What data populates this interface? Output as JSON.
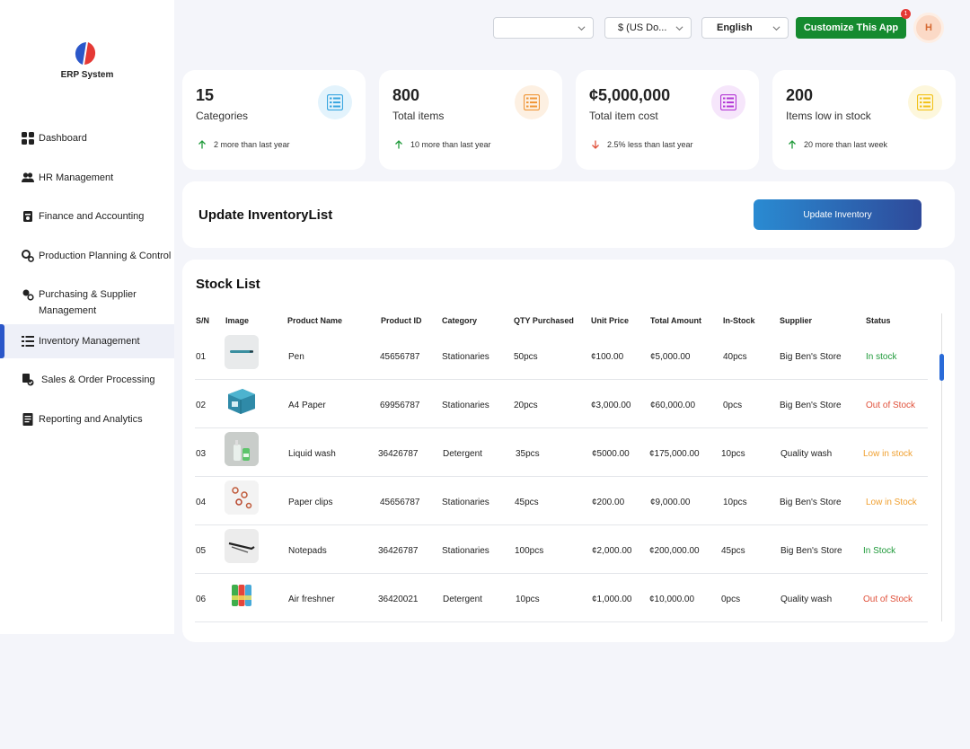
{
  "brand": {
    "name": "ERP System",
    "colors": {
      "left": "#2b57c9",
      "right": "#e53935"
    }
  },
  "sidebar": {
    "items": [
      {
        "label": "Dashboard",
        "icon": "grid-icon"
      },
      {
        "label": "HR Management",
        "icon": "users-icon"
      },
      {
        "label": "Finance and Accounting",
        "icon": "finance-icon"
      },
      {
        "label": "Production Planning & Control",
        "icon": "gears-icon"
      },
      {
        "label": "Purchasing & Supplier Management",
        "icon": "purchasing-icon"
      },
      {
        "label": "Inventory Management",
        "icon": "list-icon",
        "active": true
      },
      {
        "label": "Sales & Order Processing",
        "icon": "sales-icon"
      },
      {
        "label": "Reporting and Analytics",
        "icon": "report-icon"
      }
    ]
  },
  "topbar": {
    "branch_select": "",
    "currency_select": "$ (US Do...",
    "language_select": "English",
    "customize_label": "Customize This App",
    "notification_count": "1",
    "avatar_initial": "H"
  },
  "stats": [
    {
      "value": "15",
      "label": "Categories",
      "trend": "2 more than last year",
      "direction": "up",
      "icon_color": "#3aa6e0",
      "bg": "#e3f3fc"
    },
    {
      "value": "800",
      "label": "Total items",
      "trend": "10 more than last year",
      "direction": "up",
      "icon_color": "#f0973a",
      "bg": "#fdf0e2"
    },
    {
      "value": "¢5,000,000",
      "label": "Total item cost",
      "trend": "2.5% less than last year",
      "direction": "down",
      "icon_color": "#b43ad6",
      "bg": "#f6e6fb"
    },
    {
      "value": "200",
      "label": "Items low in stock",
      "trend": "20 more than last week",
      "direction": "up",
      "icon_color": "#f2c21b",
      "bg": "#fdf7dc"
    }
  ],
  "update_panel": {
    "title": "Update InventoryList",
    "button_label": "Update Inventory"
  },
  "stock_list": {
    "title": "Stock List",
    "columns": [
      "S/N",
      "Image",
      "Product Name",
      "Product ID",
      "Category",
      "QTY Purchased",
      "Unit Price",
      "Total Amount",
      "In-Stock",
      "Supplier",
      "Status"
    ],
    "rows": [
      {
        "sn": "01",
        "image": "pen-image",
        "name": "Pen",
        "id": "45656787",
        "category": "Stationaries",
        "qty": "50pcs",
        "unit_price": "¢100.00",
        "total": "¢5,000.00",
        "in_stock": "40pcs",
        "supplier": "Big Ben's Store",
        "status": "In stock",
        "status_type": "in"
      },
      {
        "sn": "02",
        "image": "paper-image",
        "name": "A4 Paper",
        "id": "69956787",
        "category": "Stationaries",
        "qty": "20pcs",
        "unit_price": "¢3,000.00",
        "total": "¢60,000.00",
        "in_stock": "0pcs",
        "supplier": "Big Ben's Store",
        "status": "Out of Stock",
        "status_type": "out"
      },
      {
        "sn": "03",
        "image": "liquid-wash-image",
        "name": "Liquid wash",
        "id": "36426787",
        "category": "Detergent",
        "qty": "35pcs",
        "unit_price": "¢5000.00",
        "total": "¢175,000.00",
        "in_stock": "10pcs",
        "supplier": "Quality wash",
        "status": "Low in stock",
        "status_type": "low"
      },
      {
        "sn": "04",
        "image": "paper-clips-image",
        "name": "Paper clips",
        "id": "45656787",
        "category": "Stationaries",
        "qty": "45pcs",
        "unit_price": "¢200.00",
        "total": "¢9,000.00",
        "in_stock": "10pcs",
        "supplier": "Big Ben's Store",
        "status": "Low in Stock",
        "status_type": "low"
      },
      {
        "sn": "05",
        "image": "notepads-image",
        "name": "Notepads",
        "id": "36426787",
        "category": "Stationaries",
        "qty": "100pcs",
        "unit_price": "¢2,000.00",
        "total": "¢200,000.00",
        "in_stock": "45pcs",
        "supplier": "Big Ben's Store",
        "status": "In Stock",
        "status_type": "in"
      },
      {
        "sn": "06",
        "image": "air-freshner-image",
        "name": "Air freshner",
        "id": "36420021",
        "category": "Detergent",
        "qty": "10pcs",
        "unit_price": "¢1,000.00",
        "total": "¢10,000.00",
        "in_stock": "0pcs",
        "supplier": "Quality wash",
        "status": "Out of Stock",
        "status_type": "out"
      }
    ],
    "status_colors": {
      "in": "#1f9a3a",
      "out": "#e0503a",
      "low": "#f0a030"
    }
  }
}
